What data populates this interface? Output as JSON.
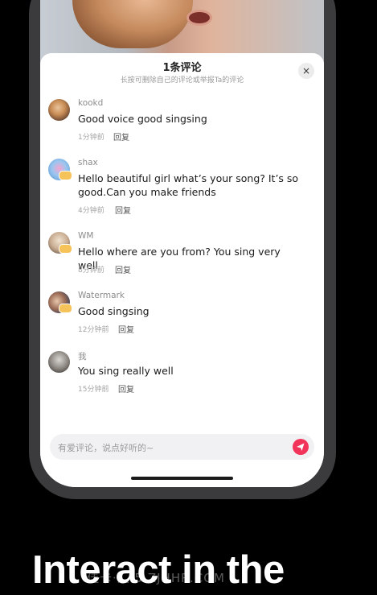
{
  "sheet": {
    "title": "1条评论",
    "subtitle": "长按可删除自己的评论或举报Ta的评论",
    "close_label": "×"
  },
  "comments": [
    {
      "name": "kookd",
      "text": "Good voice good singsing",
      "time": "1分钟前",
      "reply": "回复"
    },
    {
      "name": "shax",
      "text": "Hello beautiful girl what’s your song? It’s so good.Can you make friends",
      "time": "4分钟前",
      "reply": "回复"
    },
    {
      "name": "WM",
      "text": "Hello where are you from? You sing very well",
      "time": "8分钟前",
      "reply": "回复"
    },
    {
      "name": "Watermark",
      "text": "Good singsing",
      "time": "12分钟前",
      "reply": "回复"
    },
    {
      "name": "我",
      "text": "You sing really well",
      "time": "15分钟前",
      "reply": "回复"
    }
  ],
  "input": {
    "placeholder": "有爱评论，说点好听的~"
  },
  "icons": {
    "send": "send-icon",
    "close": "close-icon"
  },
  "colors": {
    "accent": "#f2345a",
    "badge": "#f6c35a"
  },
  "headline": "Interact in the",
  "watermark": "佳卡·汇 5 ZJHHR.COM"
}
